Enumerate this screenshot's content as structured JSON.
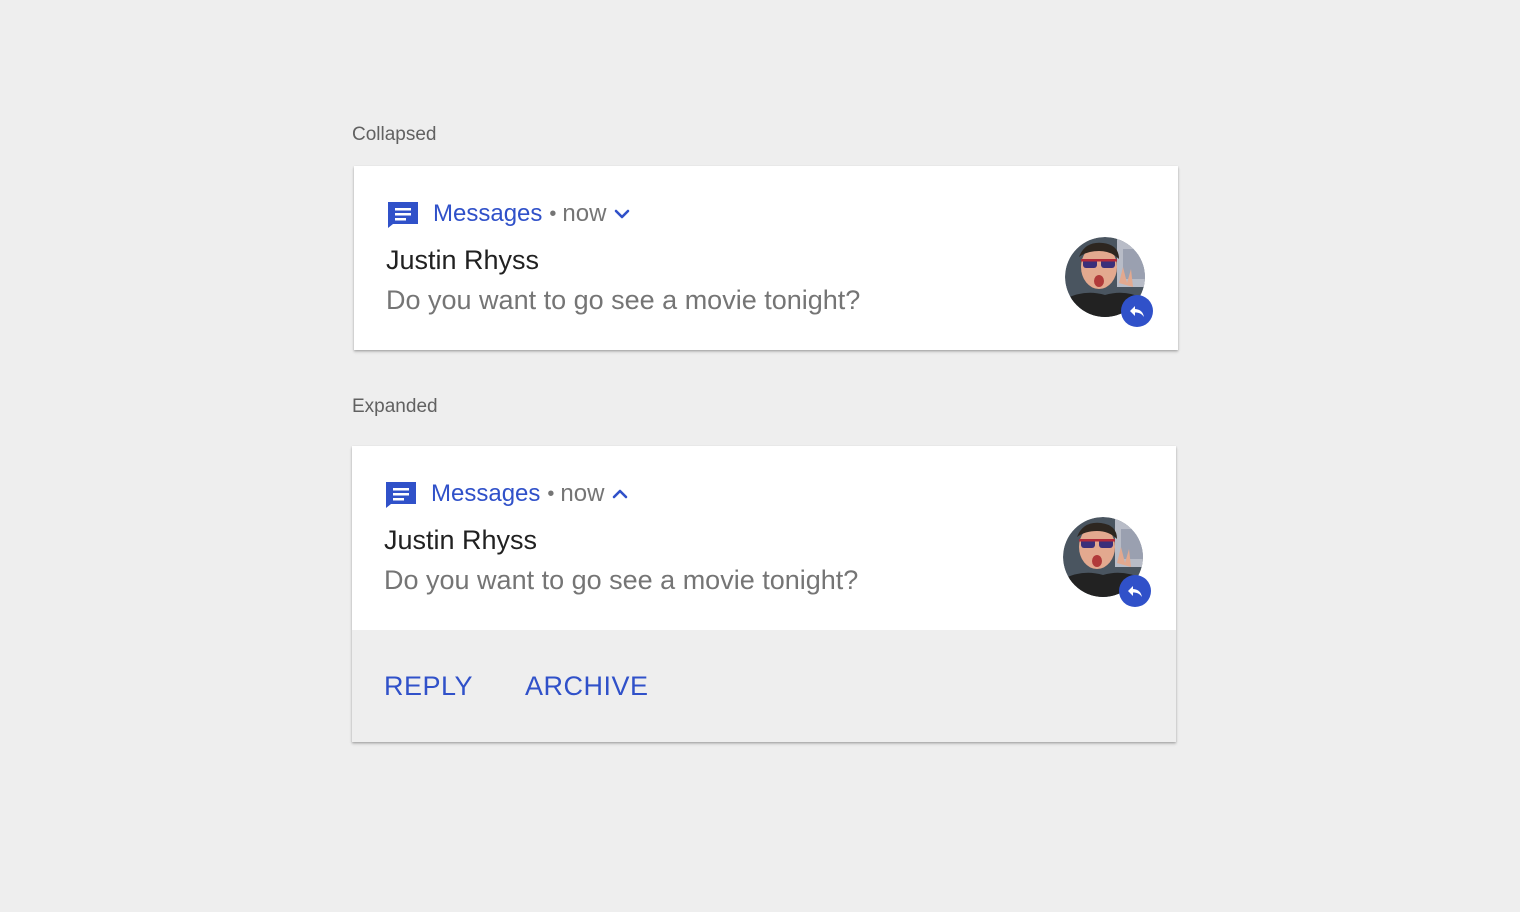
{
  "collapsed_section": {
    "label": "Collapsed",
    "notification": {
      "app_name": "Messages",
      "separator": "•",
      "time": "now",
      "title": "Justin Rhyss",
      "message": "Do you want to go see a movie tonight?",
      "chevron": "expand-more-icon"
    }
  },
  "expanded_section": {
    "label": "Expanded",
    "notification": {
      "app_name": "Messages",
      "separator": "•",
      "time": "now",
      "title": "Justin Rhyss",
      "message": "Do you want to go see a movie tonight?",
      "chevron": "expand-less-icon"
    },
    "actions": {
      "reply_label": "REPLY",
      "archive_label": "ARCHIVE"
    }
  },
  "colors": {
    "accent": "#3051c9",
    "background": "#eeeeee",
    "card": "#ffffff",
    "title_text": "#212121",
    "secondary_text": "#757575"
  },
  "icons": {
    "app": "messages-app-icon",
    "reply_badge": "reply-icon",
    "avatar": "contact-avatar"
  }
}
